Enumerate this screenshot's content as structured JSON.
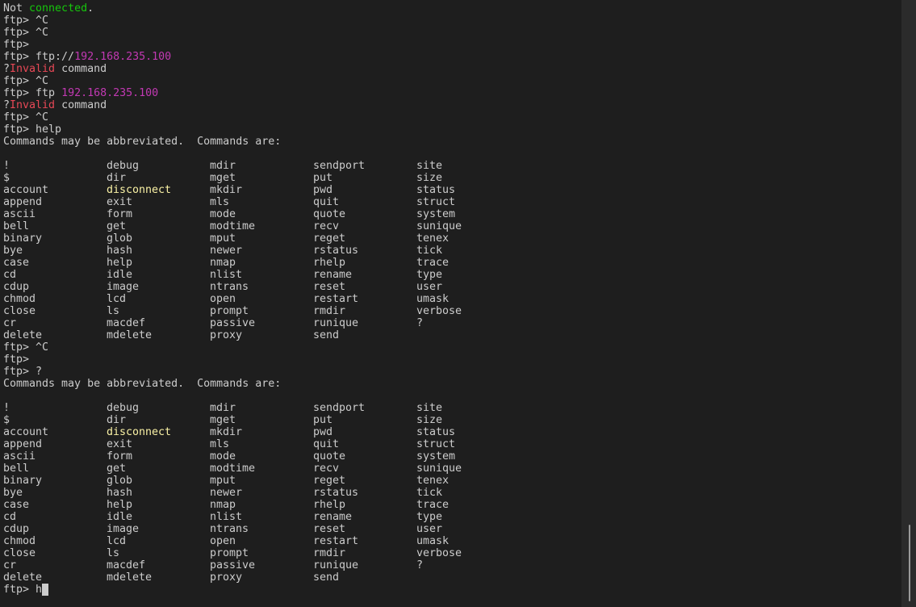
{
  "terminal": {
    "prompt": "ftp> ",
    "lines": [
      {
        "type": "text",
        "segments": [
          {
            "t": "Not "
          },
          {
            "t": "connected",
            "c": "green"
          },
          {
            "t": "."
          }
        ]
      },
      {
        "type": "text",
        "segments": [
          {
            "t": "ftp> ^C"
          }
        ]
      },
      {
        "type": "text",
        "segments": [
          {
            "t": "ftp> ^C"
          }
        ]
      },
      {
        "type": "text",
        "segments": [
          {
            "t": "ftp> "
          }
        ]
      },
      {
        "type": "text",
        "segments": [
          {
            "t": "ftp> ftp://"
          },
          {
            "t": "192.168.235.100",
            "c": "magenta"
          }
        ]
      },
      {
        "type": "text",
        "segments": [
          {
            "t": "?"
          },
          {
            "t": "Invalid",
            "c": "red"
          },
          {
            "t": " command"
          }
        ]
      },
      {
        "type": "text",
        "segments": [
          {
            "t": "ftp> ^C"
          }
        ]
      },
      {
        "type": "text",
        "segments": [
          {
            "t": "ftp> ftp "
          },
          {
            "t": "192.168.235.100",
            "c": "magenta"
          }
        ]
      },
      {
        "type": "text",
        "segments": [
          {
            "t": "?"
          },
          {
            "t": "Invalid",
            "c": "red"
          },
          {
            "t": " command"
          }
        ]
      },
      {
        "type": "text",
        "segments": [
          {
            "t": "ftp> ^C"
          }
        ]
      },
      {
        "type": "text",
        "segments": [
          {
            "t": "ftp> help"
          }
        ]
      },
      {
        "type": "text",
        "segments": [
          {
            "t": "Commands may be abbreviated.  Commands are:"
          }
        ]
      },
      {
        "type": "text",
        "segments": [
          {
            "t": ""
          }
        ]
      },
      {
        "type": "grid",
        "table": "help_table"
      },
      {
        "type": "text",
        "segments": [
          {
            "t": "ftp> ^C"
          }
        ]
      },
      {
        "type": "text",
        "segments": [
          {
            "t": "ftp> "
          }
        ]
      },
      {
        "type": "text",
        "segments": [
          {
            "t": "ftp> ?"
          }
        ]
      },
      {
        "type": "text",
        "segments": [
          {
            "t": "Commands may be abbreviated.  Commands are:"
          }
        ]
      },
      {
        "type": "text",
        "segments": [
          {
            "t": ""
          }
        ]
      },
      {
        "type": "grid",
        "table": "help_table"
      },
      {
        "type": "input",
        "segments": [
          {
            "t": "ftp> h"
          }
        ]
      }
    ],
    "help_table": [
      [
        "!",
        "debug",
        "mdir",
        "sendport",
        "site"
      ],
      [
        "$",
        "dir",
        "mget",
        "put",
        "size"
      ],
      [
        "account",
        "disconnect",
        "mkdir",
        "pwd",
        "status"
      ],
      [
        "append",
        "exit",
        "mls",
        "quit",
        "struct"
      ],
      [
        "ascii",
        "form",
        "mode",
        "quote",
        "system"
      ],
      [
        "bell",
        "get",
        "modtime",
        "recv",
        "sunique"
      ],
      [
        "binary",
        "glob",
        "mput",
        "reget",
        "tenex"
      ],
      [
        "bye",
        "hash",
        "newer",
        "rstatus",
        "tick"
      ],
      [
        "case",
        "help",
        "nmap",
        "rhelp",
        "trace"
      ],
      [
        "cd",
        "idle",
        "nlist",
        "rename",
        "type"
      ],
      [
        "cdup",
        "image",
        "ntrans",
        "reset",
        "user"
      ],
      [
        "chmod",
        "lcd",
        "open",
        "restart",
        "umask"
      ],
      [
        "close",
        "ls",
        "prompt",
        "rmdir",
        "verbose"
      ],
      [
        "cr",
        "macdef",
        "passive",
        "runique",
        "?"
      ],
      [
        "delete",
        "mdelete",
        "proxy",
        "send",
        ""
      ]
    ],
    "highlighted_commands": [
      "disconnect"
    ],
    "colors": {
      "background": "#1e1e1e",
      "foreground": "#cccccc",
      "green": "#16c60c",
      "red": "#e74856",
      "magenta": "#c239b3",
      "yellow": "#f9f1a5"
    }
  }
}
